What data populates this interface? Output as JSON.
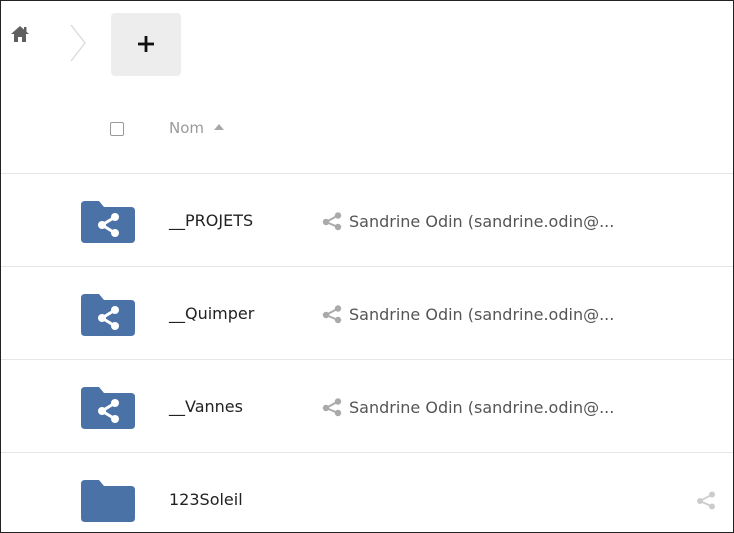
{
  "toolbar": {
    "home_icon": "home-icon",
    "separator_icon": "chevron-right-icon",
    "add_label": "+"
  },
  "header": {
    "name_column_label": "Nom",
    "sort_icon": "caret-up-icon"
  },
  "files": [
    {
      "name": "__PROJETS",
      "shared": true,
      "owner": "Sandrine Odin (sandrine.odin@..."
    },
    {
      "name": "__Quimper",
      "shared": true,
      "owner": "Sandrine Odin (sandrine.odin@..."
    },
    {
      "name": "__Vannes",
      "shared": true,
      "owner": "Sandrine Odin (sandrine.odin@..."
    },
    {
      "name": "123Soleil",
      "shared": false,
      "owner": ""
    }
  ],
  "colors": {
    "folder": "#4a72a6",
    "share_icon": "#aaaaaa",
    "border": "#e6e6e6",
    "add_button_bg": "#ededed"
  }
}
